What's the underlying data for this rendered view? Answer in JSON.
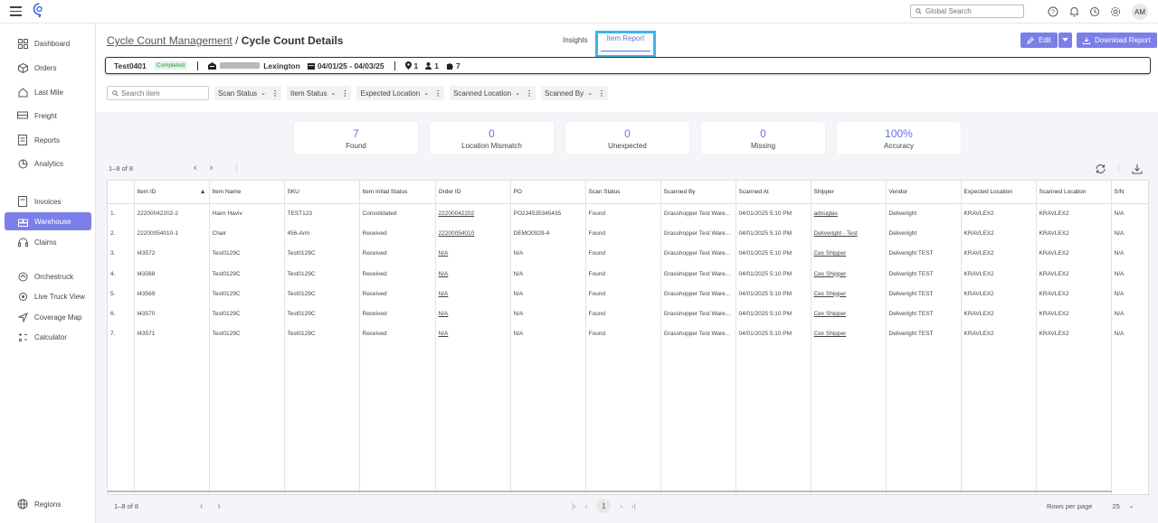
{
  "header": {
    "search_placeholder": "Global Search",
    "avatar_initials": "AM"
  },
  "sidebar": {
    "items": [
      {
        "label": "Dashboard",
        "icon": "grid-icon"
      },
      {
        "label": "Orders",
        "icon": "box-icon"
      },
      {
        "label": "Last Mile",
        "icon": "house-icon"
      },
      {
        "label": "Freight",
        "icon": "truck-icon"
      },
      {
        "label": "Reports",
        "icon": "report-icon"
      },
      {
        "label": "Analytics",
        "icon": "analytics-icon"
      },
      {
        "label": "Invoices",
        "icon": "invoice-icon"
      },
      {
        "label": "Warehouse",
        "icon": "warehouse-icon",
        "active": true
      },
      {
        "label": "Claims",
        "icon": "headset-icon"
      },
      {
        "label": "Orchestruck",
        "icon": "orchestruck-icon"
      },
      {
        "label": "Live Truck View",
        "icon": "target-icon"
      },
      {
        "label": "Coverage Map",
        "icon": "navigation-icon"
      },
      {
        "label": "Calculator",
        "icon": "calculator-icon"
      }
    ],
    "bottom_item": {
      "label": "Regions",
      "icon": "globe-icon"
    }
  },
  "page": {
    "breadcrumb_parent": "Cycle Count Management",
    "breadcrumb_sep": "/",
    "breadcrumb_current": "Cycle Count Details",
    "tabs": [
      {
        "label": "Insights"
      },
      {
        "label": "Item Report",
        "active": true
      }
    ],
    "edit_label": "Edit",
    "download_label": "Download Report"
  },
  "info": {
    "name": "Test0401",
    "status": "Completed",
    "location": "Lexington",
    "date_range": "04/01/25 - 04/03/25",
    "pin_count": "1",
    "user_count": "1",
    "item_count": "7"
  },
  "filters": {
    "search_placeholder": "Search item",
    "items": [
      "Scan Status",
      "Item Status",
      "Expected Location",
      "Scanned Location",
      "Scanned By"
    ]
  },
  "kpis": [
    {
      "value": "7",
      "label": "Found"
    },
    {
      "value": "0",
      "label": "Location Mismatch"
    },
    {
      "value": "0",
      "label": "Unexpected"
    },
    {
      "value": "0",
      "label": "Missing"
    },
    {
      "value": "100%",
      "label": "Accuracy"
    }
  ],
  "pagination": {
    "range": "1–8 of 8",
    "current_page": "1",
    "rows_per_page_label": "Rows per page",
    "rows_per_page": "25"
  },
  "table": {
    "sort_indicator": "▲",
    "columns": [
      "",
      "Item ID",
      "Item Name",
      "SKU",
      "Item Initial Status",
      "Order ID",
      "PO",
      "Scan Status",
      "Scanned By",
      "Scanned At",
      "Shipper",
      "Vendor",
      "Expected Location",
      "Scanned Location",
      "S/N"
    ],
    "rows": [
      [
        "1.",
        "22200042202-2",
        "Haim Haviv",
        "TEST123",
        "Consolidated",
        "22200042202",
        "PO234535345435",
        "Found",
        "Grasshopper Test Ware...",
        "04/01/2025 5:10 PM",
        "adouglas",
        "Deliveright",
        "KRAVLEX2",
        "KRAVLEX2",
        "N/A"
      ],
      [
        "2.",
        "22200054010-1",
        "Chair",
        "456-Arm",
        "Received",
        "22200054010",
        "DEMO0929-4",
        "Found",
        "Grasshopper Test Ware...",
        "04/01/2025 5:10 PM",
        "Deliveright - Test",
        "Deliveright",
        "KRAVLEX2",
        "KRAVLEX2",
        "N/A"
      ],
      [
        "3.",
        "I43572",
        "Test0129C",
        "Test0129C",
        "Received",
        "N/A",
        "N/A",
        "Found",
        "Grasshopper Test Ware...",
        "04/01/2025 5:10 PM",
        "Cex Shipper",
        "Deliveright TEST",
        "KRAVLEX2",
        "KRAVLEX2",
        "N/A"
      ],
      [
        "4.",
        "I43568",
        "Test0129C",
        "Test0129C",
        "Received",
        "N/A",
        "N/A",
        "Found",
        "Grasshopper Test Ware...",
        "04/01/2025 5:10 PM",
        "Cex Shipper",
        "Deliveright TEST",
        "KRAVLEX2",
        "KRAVLEX2",
        "N/A"
      ],
      [
        "5.",
        "I43569",
        "Test0129C",
        "Test0129C",
        "Received",
        "N/A",
        "N/A",
        "Found",
        "Grasshopper Test Ware...",
        "04/01/2025 5:10 PM",
        "Cex Shipper",
        "Deliveright TEST",
        "KRAVLEX2",
        "KRAVLEX2",
        "N/A"
      ],
      [
        "6.",
        "I43570",
        "Test0129C",
        "Test0129C",
        "Received",
        "N/A",
        "N/A",
        "Found",
        "Grasshopper Test Ware...",
        "04/01/2025 5:10 PM",
        "Cex Shipper",
        "Deliveright TEST",
        "KRAVLEX2",
        "KRAVLEX2",
        "N/A"
      ],
      [
        "7.",
        "I43571",
        "Test0129C",
        "Test0129C",
        "Received",
        "N/A",
        "N/A",
        "Found",
        "Grasshopper Test Ware...",
        "04/01/2025 5:10 PM",
        "Cex Shipper",
        "Deliveright TEST",
        "KRAVLEX2",
        "KRAVLEX2",
        "N/A"
      ]
    ]
  },
  "colors": {
    "accent": "#7b7fe8",
    "highlight": "#3fb3e8",
    "badge_bg": "#e2f4e4",
    "badge_text": "#3a8c45"
  }
}
